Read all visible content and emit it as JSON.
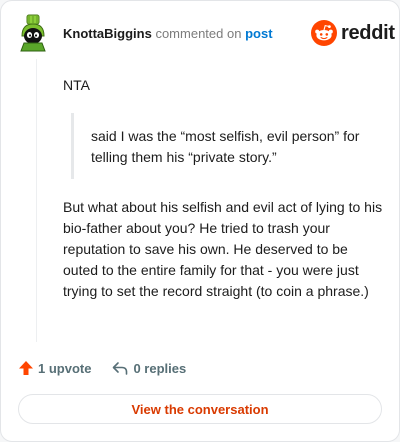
{
  "header": {
    "username": "KnottaBiggins",
    "action_text": "commented on",
    "post_link": "post",
    "logo_text": "reddit"
  },
  "comment": {
    "intro": "NTA",
    "quote": "said I was the “most selfish, evil person” for telling them his “private story.”",
    "body": "But what about his selfish and evil act of lying to his bio-father about you? He tried to trash your reputation to save his own. He deserved to be outed to the entire family for that - you were just trying to set the record straight (to coin a phrase.)"
  },
  "actions": {
    "upvotes": "1 upvote",
    "replies": "0 replies"
  },
  "footer": {
    "button_label": "View the conversation"
  },
  "icons": {
    "avatar": "marvin-martian-avatar-icon",
    "logo": "reddit-snoo-icon",
    "upvote": "upvote-arrow-icon",
    "reply": "reply-arrow-icon"
  },
  "colors": {
    "reddit_orange": "#ff4500",
    "link_blue": "#0079d3",
    "button_text": "#d93a00"
  }
}
